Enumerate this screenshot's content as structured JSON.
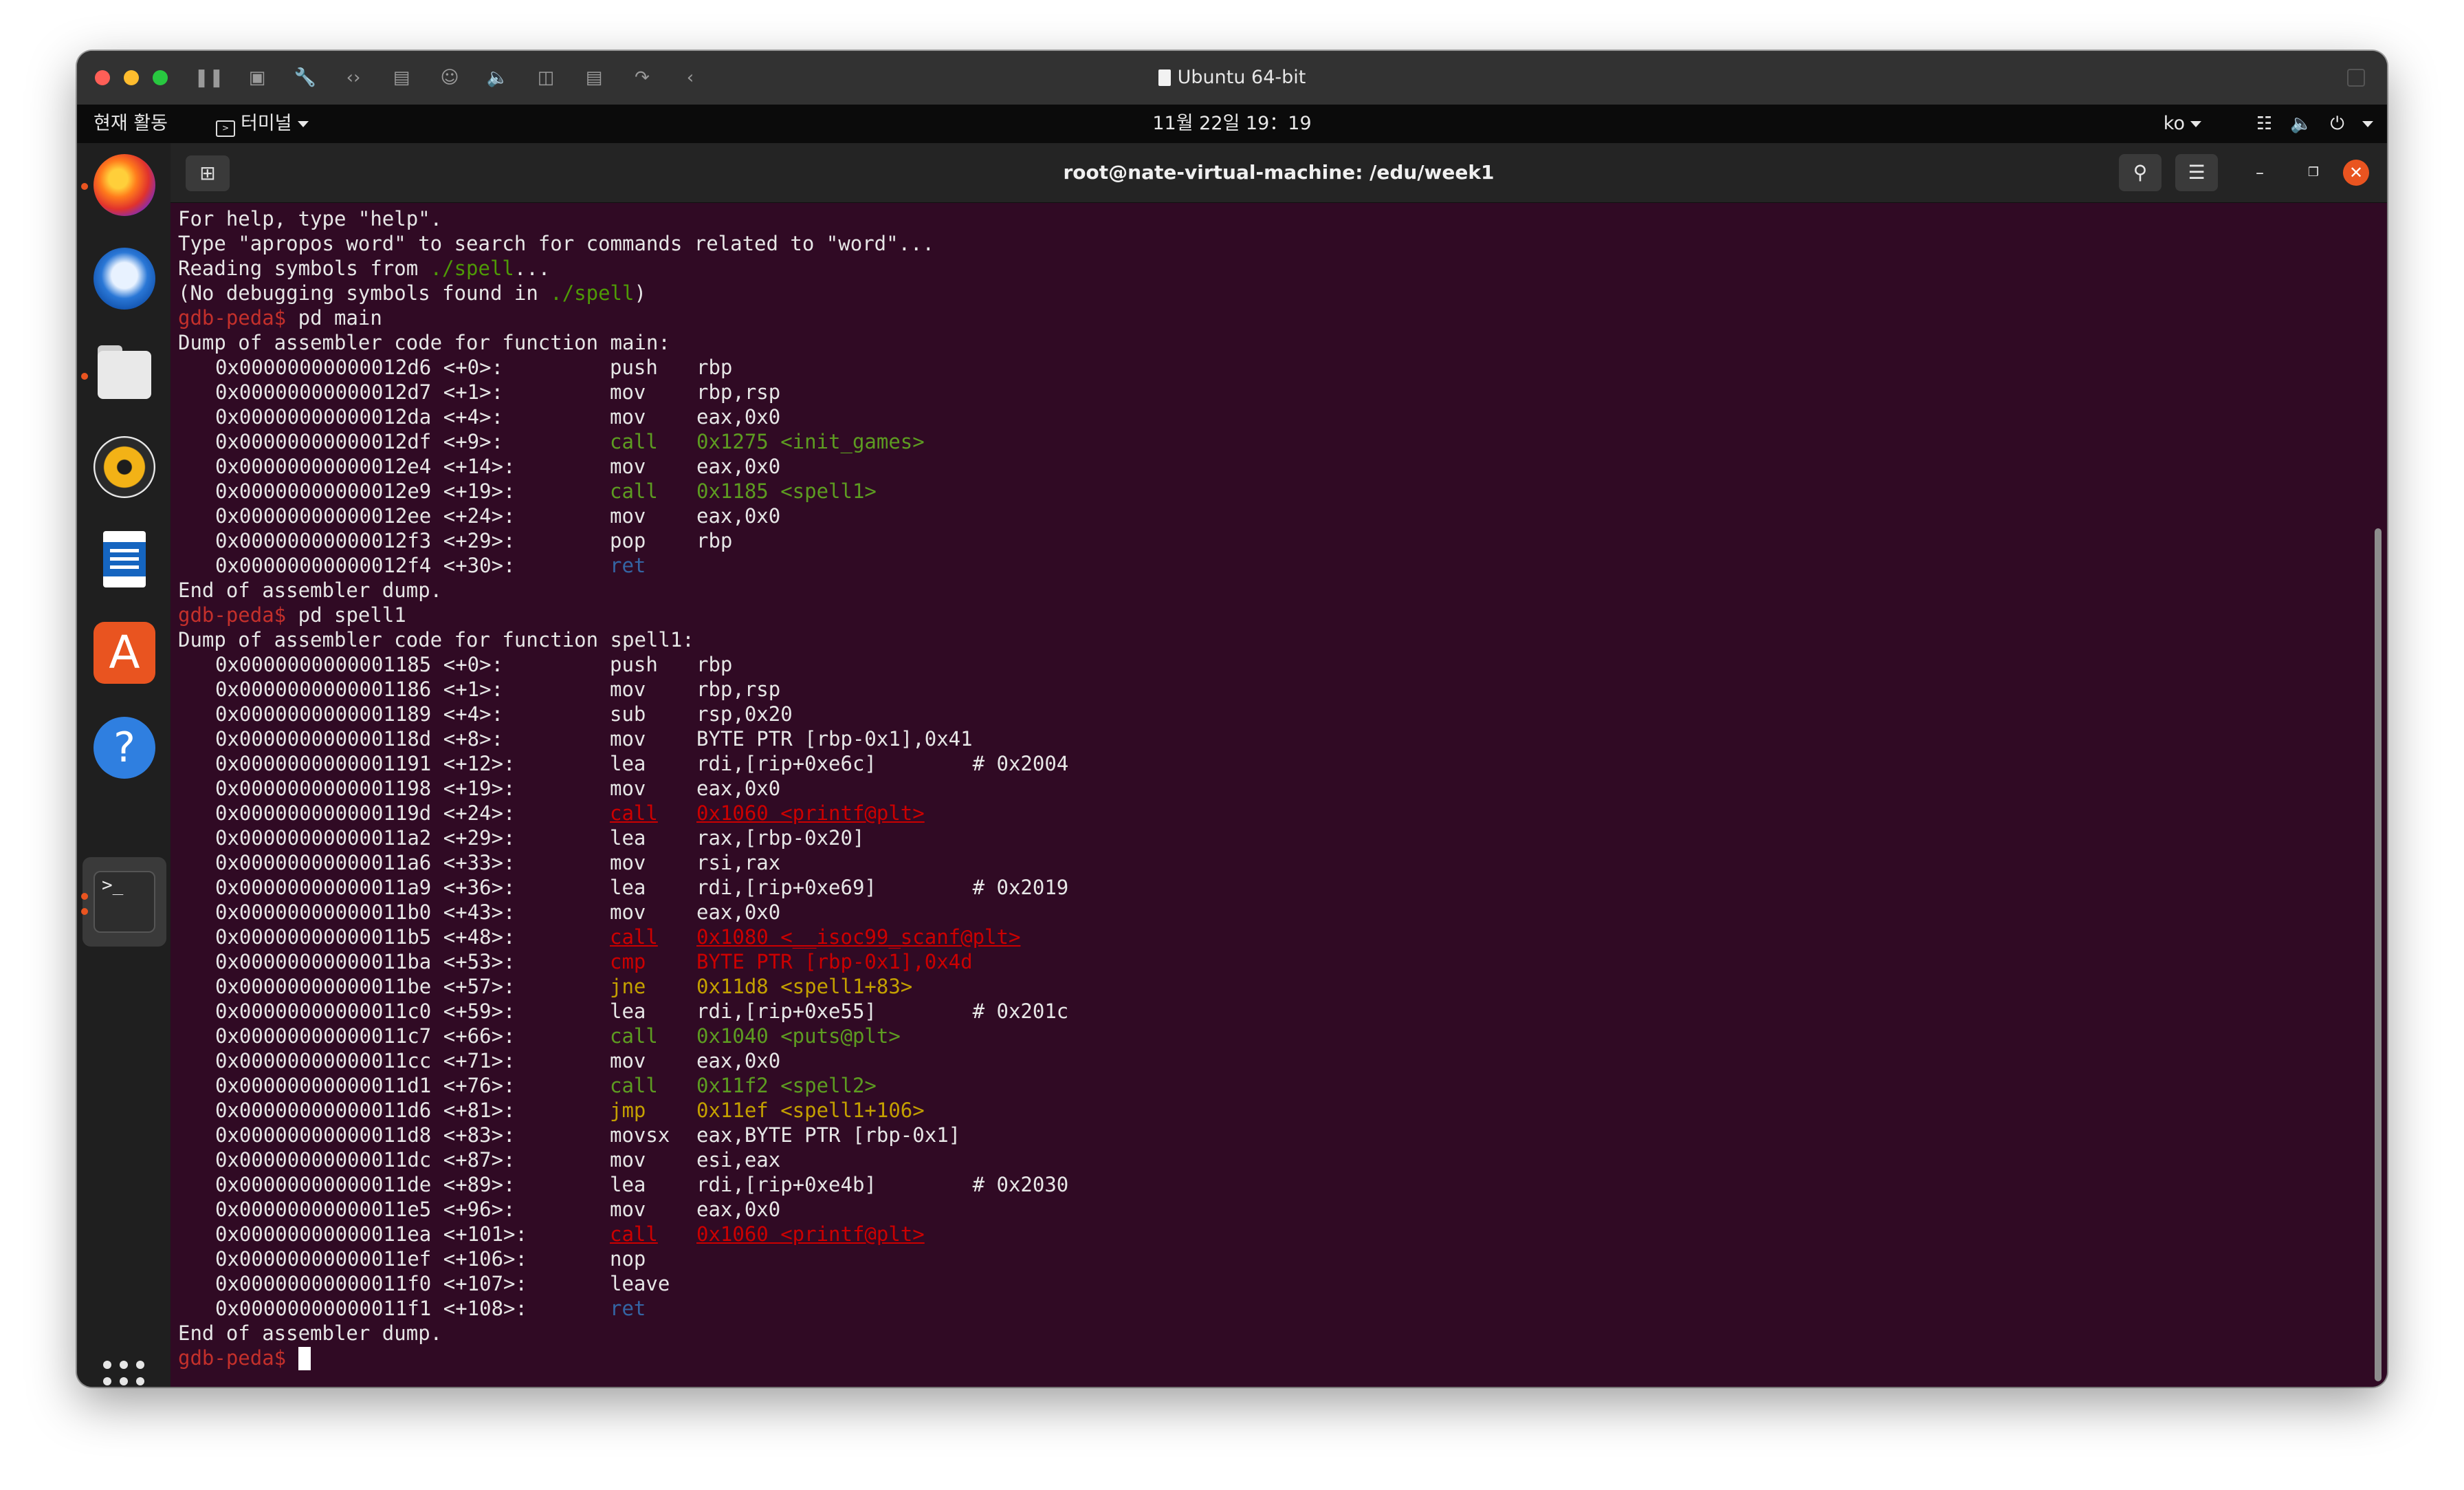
{
  "vm_window": {
    "title": "Ubuntu 64-bit",
    "toolbar_icons": [
      "pause-icon",
      "snapshot-icon",
      "settings-wrench-icon",
      "code-arrows-icon",
      "hard-disk-icon",
      "user-icon",
      "audio-icon",
      "camera-icon",
      "printer-icon",
      "share-icon",
      "chevron-left-icon"
    ]
  },
  "top_bar": {
    "activities": "현재 활동",
    "app_menu": "터미널",
    "clock": "11월 22일  19：19",
    "input_lang": "ko"
  },
  "terminal": {
    "title": "root@nate-virtual-machine: /edu/week1",
    "lines": [
      {
        "kind": "text",
        "parts": [
          {
            "t": "For help, type \"help\"."
          }
        ]
      },
      {
        "kind": "text",
        "parts": [
          {
            "t": "Type \"apropos word\" to search for commands related to \"word\"..."
          }
        ]
      },
      {
        "kind": "text",
        "parts": [
          {
            "t": "Reading symbols from "
          },
          {
            "t": "./spell",
            "c": "path"
          },
          {
            "t": "..."
          }
        ]
      },
      {
        "kind": "text",
        "parts": [
          {
            "t": "(No debugging symbols found in "
          },
          {
            "t": "./spell",
            "c": "path"
          },
          {
            "t": ")"
          }
        ]
      },
      {
        "kind": "text",
        "parts": [
          {
            "t": "gdb-peda$ ",
            "c": "prompt"
          },
          {
            "t": "pd main"
          }
        ]
      },
      {
        "kind": "text",
        "parts": [
          {
            "t": "Dump of assembler code for function main:"
          }
        ]
      },
      {
        "kind": "ins",
        "addr": "0x00000000000012d6 <+0>:",
        "mn": "push",
        "ops": "rbp"
      },
      {
        "kind": "ins",
        "addr": "0x00000000000012d7 <+1>:",
        "mn": "mov",
        "ops": "rbp,rsp"
      },
      {
        "kind": "ins",
        "addr": "0x00000000000012da <+4>:",
        "mn": "mov",
        "ops": "eax,0x0"
      },
      {
        "kind": "ins",
        "addr": "0x00000000000012df <+9>:",
        "mn": "call",
        "ops": "0x1275 <init_games>",
        "c": "op-call"
      },
      {
        "kind": "ins",
        "addr": "0x00000000000012e4 <+14>:",
        "mn": "mov",
        "ops": "eax,0x0"
      },
      {
        "kind": "ins",
        "addr": "0x00000000000012e9 <+19>:",
        "mn": "call",
        "ops": "0x1185 <spell1>",
        "c": "op-call"
      },
      {
        "kind": "ins",
        "addr": "0x00000000000012ee <+24>:",
        "mn": "mov",
        "ops": "eax,0x0"
      },
      {
        "kind": "ins",
        "addr": "0x00000000000012f3 <+29>:",
        "mn": "pop",
        "ops": "rbp"
      },
      {
        "kind": "ins",
        "addr": "0x00000000000012f4 <+30>:",
        "mn": "ret",
        "ops": "",
        "c": "op-ret"
      },
      {
        "kind": "text",
        "parts": [
          {
            "t": "End of assembler dump."
          }
        ]
      },
      {
        "kind": "text",
        "parts": [
          {
            "t": "gdb-peda$ ",
            "c": "prompt"
          },
          {
            "t": "pd spell1"
          }
        ]
      },
      {
        "kind": "text",
        "parts": [
          {
            "t": "Dump of assembler code for function spell1:"
          }
        ]
      },
      {
        "kind": "ins",
        "addr": "0x0000000000001185 <+0>:",
        "mn": "push",
        "ops": "rbp"
      },
      {
        "kind": "ins",
        "addr": "0x0000000000001186 <+1>:",
        "mn": "mov",
        "ops": "rbp,rsp"
      },
      {
        "kind": "ins",
        "addr": "0x0000000000001189 <+4>:",
        "mn": "sub",
        "ops": "rsp,0x20"
      },
      {
        "kind": "ins",
        "addr": "0x000000000000118d <+8>:",
        "mn": "mov",
        "ops": "BYTE PTR [rbp-0x1],0x41"
      },
      {
        "kind": "ins",
        "addr": "0x0000000000001191 <+12>:",
        "mn": "lea",
        "ops": "rdi,[rip+0xe6c]        # 0x2004"
      },
      {
        "kind": "ins",
        "addr": "0x0000000000001198 <+19>:",
        "mn": "mov",
        "ops": "eax,0x0"
      },
      {
        "kind": "ins",
        "addr": "0x000000000000119d <+24>:",
        "mn": "call",
        "ops": "0x1060 <printf@plt>",
        "c": "op-red-u"
      },
      {
        "kind": "ins",
        "addr": "0x00000000000011a2 <+29>:",
        "mn": "lea",
        "ops": "rax,[rbp-0x20]"
      },
      {
        "kind": "ins",
        "addr": "0x00000000000011a6 <+33>:",
        "mn": "mov",
        "ops": "rsi,rax"
      },
      {
        "kind": "ins",
        "addr": "0x00000000000011a9 <+36>:",
        "mn": "lea",
        "ops": "rdi,[rip+0xe69]        # 0x2019"
      },
      {
        "kind": "ins",
        "addr": "0x00000000000011b0 <+43>:",
        "mn": "mov",
        "ops": "eax,0x0"
      },
      {
        "kind": "ins",
        "addr": "0x00000000000011b5 <+48>:",
        "mn": "call",
        "ops": "0x1080 <__isoc99_scanf@plt>",
        "c": "op-red-u"
      },
      {
        "kind": "ins",
        "addr": "0x00000000000011ba <+53>:",
        "mn": "cmp",
        "ops": "BYTE PTR [rbp-0x1],0x4d",
        "c": "op-red"
      },
      {
        "kind": "ins",
        "addr": "0x00000000000011be <+57>:",
        "mn": "jne",
        "ops": "0x11d8 <spell1+83>",
        "c": "op-jmp"
      },
      {
        "kind": "ins",
        "addr": "0x00000000000011c0 <+59>:",
        "mn": "lea",
        "ops": "rdi,[rip+0xe55]        # 0x201c"
      },
      {
        "kind": "ins",
        "addr": "0x00000000000011c7 <+66>:",
        "mn": "call",
        "ops": "0x1040 <puts@plt>",
        "c": "op-call"
      },
      {
        "kind": "ins",
        "addr": "0x00000000000011cc <+71>:",
        "mn": "mov",
        "ops": "eax,0x0"
      },
      {
        "kind": "ins",
        "addr": "0x00000000000011d1 <+76>:",
        "mn": "call",
        "ops": "0x11f2 <spell2>",
        "c": "op-call"
      },
      {
        "kind": "ins",
        "addr": "0x00000000000011d6 <+81>:",
        "mn": "jmp",
        "ops": "0x11ef <spell1+106>",
        "c": "op-jmp"
      },
      {
        "kind": "ins",
        "addr": "0x00000000000011d8 <+83>:",
        "mn": "movsx",
        "ops": "eax,BYTE PTR [rbp-0x1]"
      },
      {
        "kind": "ins",
        "addr": "0x00000000000011dc <+87>:",
        "mn": "mov",
        "ops": "esi,eax"
      },
      {
        "kind": "ins",
        "addr": "0x00000000000011de <+89>:",
        "mn": "lea",
        "ops": "rdi,[rip+0xe4b]        # 0x2030"
      },
      {
        "kind": "ins",
        "addr": "0x00000000000011e5 <+96>:",
        "mn": "mov",
        "ops": "eax,0x0"
      },
      {
        "kind": "ins",
        "addr": "0x00000000000011ea <+101>:",
        "mn": "call",
        "ops": "0x1060 <printf@plt>",
        "c": "op-red-u"
      },
      {
        "kind": "ins",
        "addr": "0x00000000000011ef <+106>:",
        "mn": "nop",
        "ops": ""
      },
      {
        "kind": "ins",
        "addr": "0x00000000000011f0 <+107>:",
        "mn": "leave",
        "ops": ""
      },
      {
        "kind": "ins",
        "addr": "0x00000000000011f1 <+108>:",
        "mn": "ret",
        "ops": "",
        "c": "op-ret"
      },
      {
        "kind": "text",
        "parts": [
          {
            "t": "End of assembler dump."
          }
        ]
      },
      {
        "kind": "text",
        "parts": [
          {
            "t": "gdb-peda$ ",
            "c": "prompt"
          }
        ],
        "cursor": true
      }
    ]
  },
  "dock": {
    "apps": [
      "firefox-icon",
      "thunderbird-icon",
      "files-icon",
      "rhythmbox-icon",
      "libreoffice-writer-icon",
      "app-center-icon",
      "help-icon",
      "terminal-icon"
    ],
    "terminal_glyph": ">_",
    "help_glyph": "?",
    "store_glyph": "A"
  },
  "colors": {
    "terminal_bg": "#300a24",
    "prompt": "#c4302b",
    "path": "#4e9a06",
    "call": "#5d9c21",
    "ret": "#3465a4",
    "jump": "#c4a000",
    "danger": "#cc0000",
    "close_button": "#e95420"
  }
}
